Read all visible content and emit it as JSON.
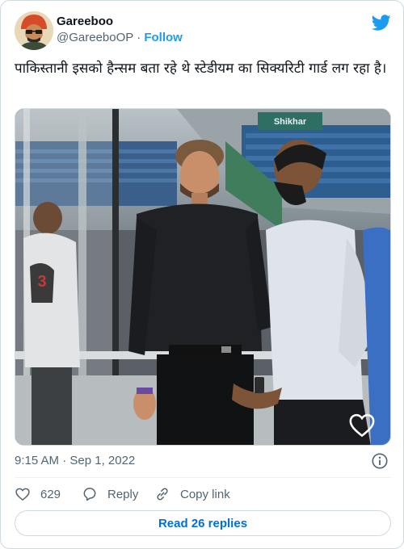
{
  "author": {
    "display_name": "Gareeboo",
    "handle": "@GareeboOP",
    "separator": "·",
    "follow_label": "Follow"
  },
  "tweet": {
    "text": "पाकिस्तानी इसको हैन्सम बता रहे थे स्टेडीयम का सिक्यरिटी गार्ड लग रहा है।",
    "timestamp": "9:15 AM · Sep 1, 2022"
  },
  "media": {
    "stadium_sign": "Shikhar",
    "player_jersey_number": "3"
  },
  "actions": {
    "like_count": "629",
    "reply_label": "Reply",
    "copy_link_label": "Copy link"
  },
  "footer": {
    "read_replies_label": "Read 26 replies"
  },
  "colors": {
    "brand_blue": "#1d9bf0",
    "link_blue": "#006fd6",
    "muted_text": "#536471",
    "border": "#cfd9de"
  },
  "icons": [
    "twitter-bird-icon",
    "heart-icon",
    "reply-icon",
    "link-icon",
    "info-icon"
  ]
}
